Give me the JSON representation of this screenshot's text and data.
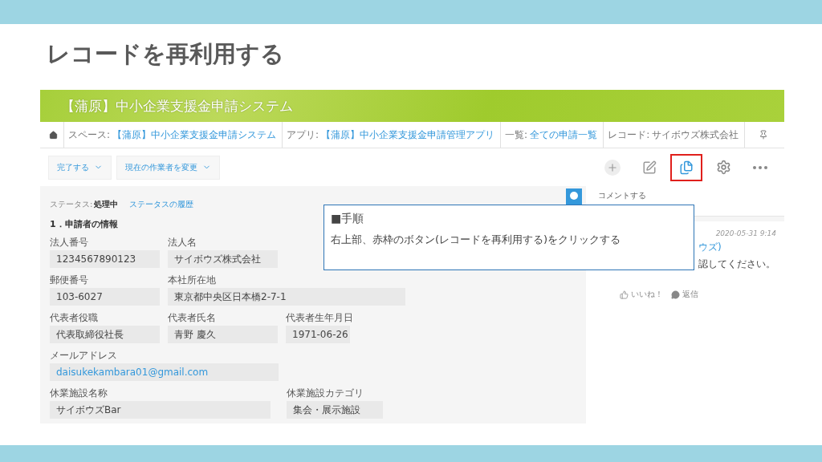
{
  "slide_title": "レコードを再利用する",
  "app": {
    "header_title": "【蒲原】中小企業支援金申請システム",
    "breadcrumbs": [
      {
        "kind": "home"
      },
      {
        "kind": "link",
        "prefix": "スペース:",
        "link": "【蒲原】中小企業支援金申請システム"
      },
      {
        "kind": "link",
        "prefix": "アプリ:",
        "link": "【蒲原】中小企業支援金申請管理アプリ"
      },
      {
        "kind": "link",
        "prefix": "一覧:",
        "link": "全ての申請一覧"
      },
      {
        "kind": "current",
        "prefix": "レコード:",
        "link": "サイボウズ株式会社"
      }
    ],
    "actions": [
      "完了する",
      "現在の作業者を変更"
    ],
    "toolbar_icons": [
      {
        "kind": "add",
        "highlighted": false
      },
      {
        "kind": "edit",
        "highlighted": false
      },
      {
        "kind": "reuse",
        "highlighted": true
      },
      {
        "kind": "settings",
        "highlighted": false
      },
      {
        "kind": "more",
        "highlighted": false
      }
    ],
    "status": {
      "label": "ステータス:",
      "value": "処理中",
      "history_link": "ステータスの履歴"
    },
    "section_title": "1．申請者の情報",
    "rows": [
      [
        {
          "label": "法人番号",
          "value": "1234567890123",
          "kind": "text"
        },
        {
          "label": "法人名",
          "value": "サイボウズ株式会社",
          "kind": "text"
        }
      ],
      [
        {
          "label": "郵便番号",
          "value": "103-6027",
          "kind": "text"
        },
        {
          "label": "本社所在地",
          "value": "東京都中央区日本橋2-7-1",
          "kind": "text"
        }
      ],
      [
        {
          "label": "代表者役職",
          "value": "代表取締役社長",
          "kind": "text"
        },
        {
          "label": "代表者氏名",
          "value": "青野 慶久",
          "kind": "text"
        },
        {
          "label": "代表者生年月日",
          "value": "1971-06-26",
          "kind": "text"
        }
      ],
      [
        {
          "label": "メールアドレス",
          "value": "daisukekambara01@gmail.com",
          "kind": "email"
        }
      ],
      [
        {
          "label": "休業施設名称",
          "value": "サイボウズBar",
          "kind": "text"
        },
        {
          "kind": "empty"
        },
        {
          "label": "休業施設カテゴリ",
          "value": "集会・展示施設",
          "kind": "text"
        }
      ]
    ],
    "comments": {
      "placeholder": "コメントする",
      "date": "2020-05-31 9:14",
      "author": "ウズ)",
      "text": "認してください。",
      "like": "いいね！",
      "reply": "返信"
    }
  },
  "callout": {
    "heading": "■手順",
    "body": "右上部、赤枠のボタン(レコードを再利用する)をクリックする"
  }
}
